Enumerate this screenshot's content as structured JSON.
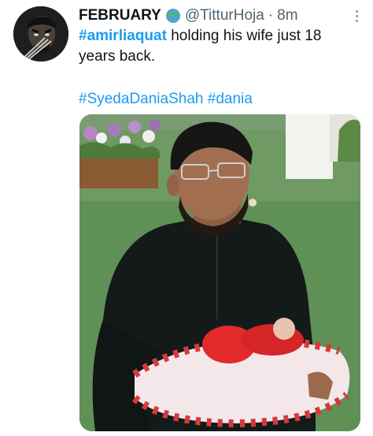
{
  "tweet": {
    "display_name": "FEBRUARY",
    "handle": "@TitturHoja",
    "separator": "·",
    "time": "8m",
    "body": {
      "hashtag_main": "#amirliaquat",
      "text_after": " holding his wife just 18 years back."
    },
    "hashtags": [
      "#SyedaDaniaShah",
      "#dania"
    ],
    "icons": {
      "badge": "globe-emoji-icon",
      "more": "more-options-icon"
    },
    "colors": {
      "link": "#1d9bf0",
      "secondary_text": "#536471",
      "primary_text": "#0f1419"
    }
  }
}
